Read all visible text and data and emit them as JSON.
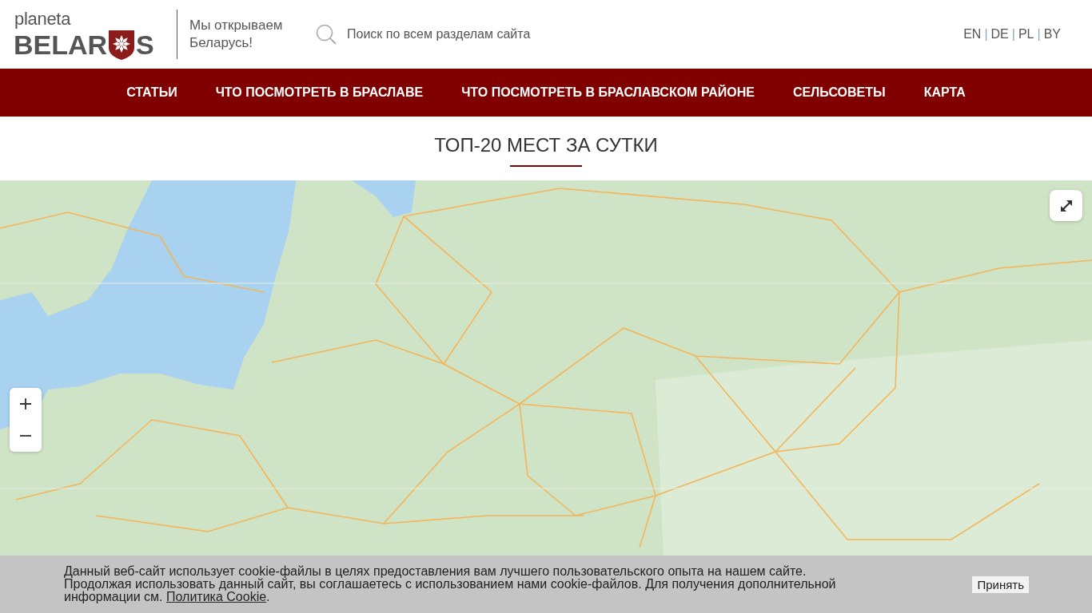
{
  "header": {
    "logo": {
      "top": "planeta",
      "word_start": "BELAR",
      "word_end": "S"
    },
    "tagline": "Мы открываем Беларусь!",
    "search": {
      "placeholder": "Поиск по всем разделам сайта"
    },
    "languages": [
      "EN",
      "DE",
      "PL",
      "BY"
    ],
    "language_separators": [
      "|",
      "|",
      "|"
    ]
  },
  "nav": {
    "items": [
      "СТАТЬИ",
      "ЧТО ПОСМОТРЕТЬ В БРАСЛАВЕ",
      "ЧТО ПОСМОТРЕТЬ В БРАСЛАВСКОМ РАЙОНЕ",
      "СЕЛЬСОВЕТЫ",
      "КАРТА"
    ]
  },
  "section": {
    "title": "ТОП-20 МЕСТ ЗА СУТКИ"
  },
  "cookie_banner": {
    "text": "Данный веб-сайт использует cookie-файлы в целях предоставления вам лучшего пользовательского опыта на нашем сайте. Продолжая использовать данный сайт, вы соглашаетесь с использованием нами cookie-файлов. Для получения дополнительной информации см.",
    "link": "Политика Cookie",
    "text_end": ".",
    "button": "Принять"
  }
}
